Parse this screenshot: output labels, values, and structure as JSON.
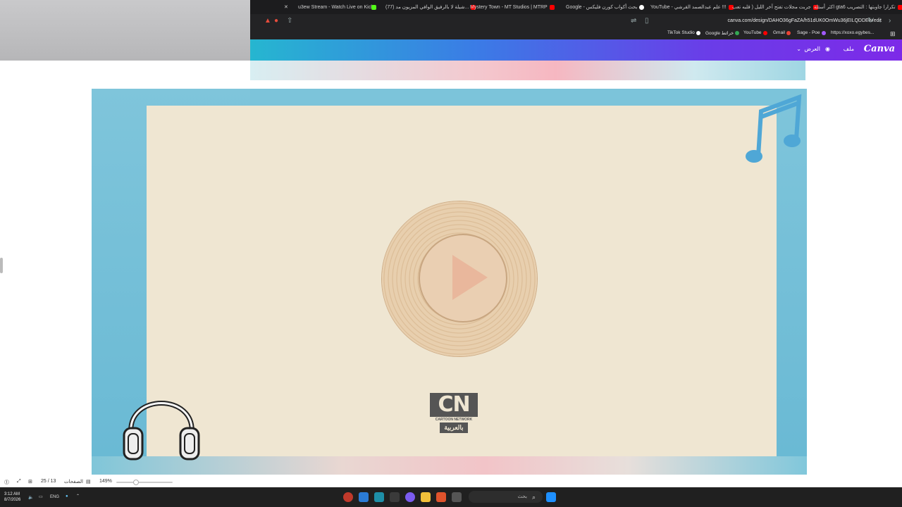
{
  "browser": {
    "tabs": [
      {
        "label": "u3ew Stream - Watch Live on Kick",
        "color": "#53fc18"
      },
      {
        "label": "(77) شيلة لا بالرفيق الوافي المزيون مد...",
        "color": "#ff0000"
      },
      {
        "label": "Mystery Town - MT Studios | MTRP",
        "color": "#ff0000"
      },
      {
        "label": "Google - بحث أكواب كورن فليكس",
        "color": "#ffffff"
      },
      {
        "label": "YouTube - علم عبدالصمد القرشي !!!",
        "color": "#ff0000"
      },
      {
        "label": "جربت مجلات تفتح آخر الليل ( قلبه تعب",
        "color": "#ff0000"
      },
      {
        "label": "اكثر أسئلة gta6 تكرارا جاوبتها : التصريب",
        "color": "#ff0000"
      }
    ],
    "url": "canva.com/design/DAHO36gFaZA/h51dUK0OmWu36jEILQDDEw/edit",
    "bookmarks": [
      {
        "label": "TikTok Studio",
        "color": "#ffffff"
      },
      {
        "label": "Google خرائط",
        "color": "#34a853"
      },
      {
        "label": "YouTube",
        "color": "#ff0000"
      },
      {
        "label": "Gmail",
        "color": "#ea4335"
      },
      {
        "label": "Sage - Poe",
        "color": "#a259ff"
      },
      {
        "label": "https://xoxo.egybes...",
        "color": "#888888"
      }
    ]
  },
  "canva_header": {
    "logo": "Canva",
    "file_menu": "ملف",
    "view_menu": "العرض"
  },
  "design": {
    "logo_main": "CN",
    "logo_sub": "CARTOON NETWORK",
    "logo_arabic": "بالعربية"
  },
  "footer": {
    "zoom": "149%",
    "pages_label": "الصفحات",
    "page_counter": "25 / 13",
    "zoom_fraction": 0.35
  },
  "taskbar": {
    "time": "3:12 AM",
    "date": "8/7/2026",
    "lang": "ENG",
    "search_placeholder": "بحث"
  },
  "colors": {
    "canva_gradient_start": "#26b6d0",
    "canva_gradient_end": "#7d2ae8",
    "panel_cream": "#efe6d2",
    "frame_blue": "#69b9d4"
  }
}
